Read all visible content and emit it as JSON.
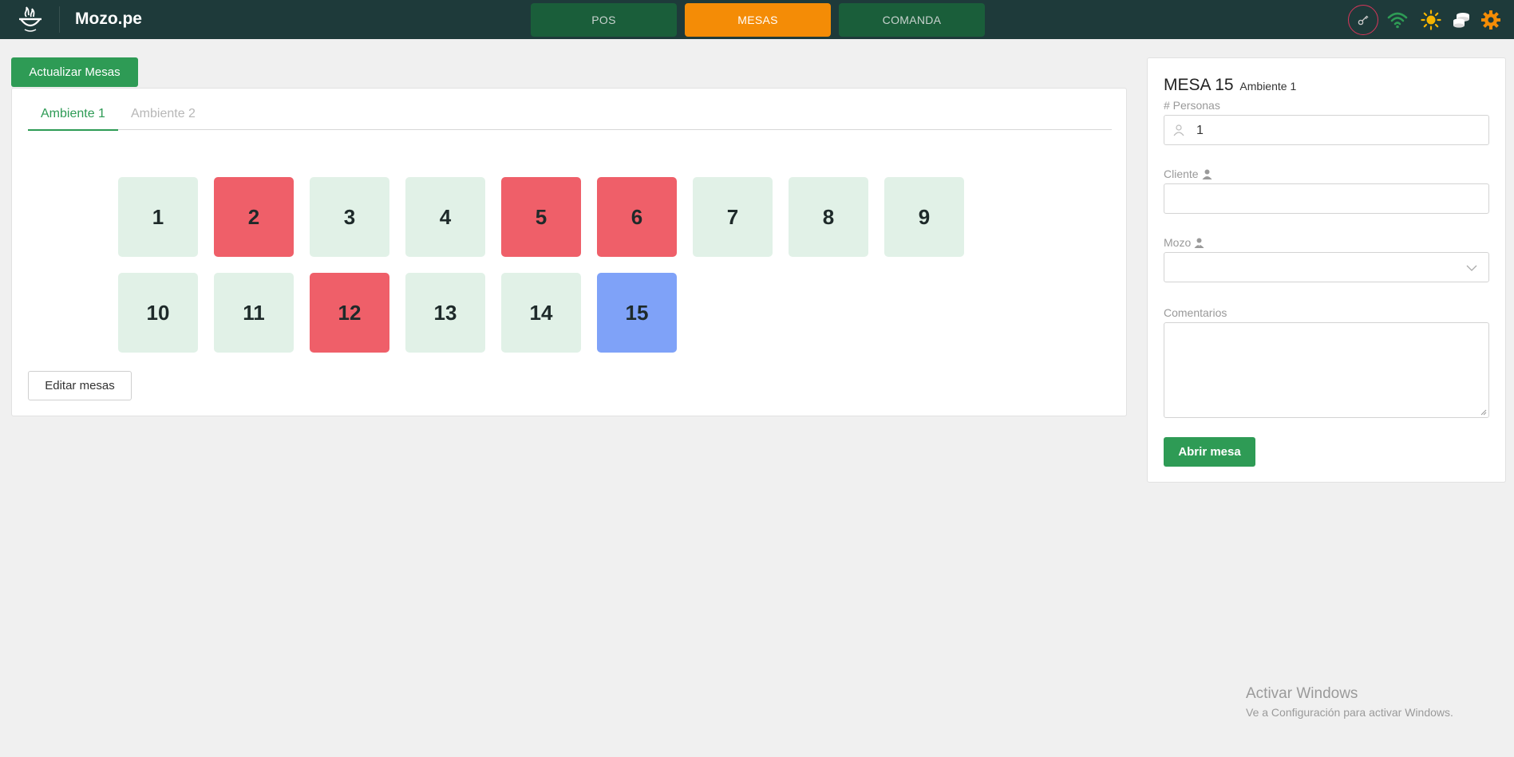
{
  "header": {
    "brand": "Mozo.pe",
    "nav": [
      {
        "label": "POS"
      },
      {
        "label": "MESAS"
      },
      {
        "label": "COMANDA"
      }
    ],
    "icons": [
      "key-icon",
      "wifi-icon",
      "sun-icon",
      "coins-icon",
      "gear-icon"
    ],
    "colors": {
      "bar": "#1e3a3a",
      "tab": "#1a5e3a",
      "active_tab": "#f48c06"
    }
  },
  "toolbar": {
    "update_label": "Actualizar Mesas"
  },
  "rooms": {
    "tabs": [
      {
        "label": "Ambiente 1"
      },
      {
        "label": "Ambiente 2"
      }
    ],
    "tables": [
      {
        "number": "1",
        "status": "free"
      },
      {
        "number": "2",
        "status": "busy"
      },
      {
        "number": "3",
        "status": "free"
      },
      {
        "number": "4",
        "status": "free"
      },
      {
        "number": "5",
        "status": "busy"
      },
      {
        "number": "6",
        "status": "busy"
      },
      {
        "number": "7",
        "status": "free"
      },
      {
        "number": "8",
        "status": "free"
      },
      {
        "number": "9",
        "status": "free"
      },
      {
        "number": "10",
        "status": "free"
      },
      {
        "number": "11",
        "status": "free"
      },
      {
        "number": "12",
        "status": "busy"
      },
      {
        "number": "13",
        "status": "free"
      },
      {
        "number": "14",
        "status": "free"
      },
      {
        "number": "15",
        "status": "selected"
      }
    ],
    "edit_label": "Editar mesas"
  },
  "detail": {
    "title": "MESA 15",
    "ambiente": "Ambiente 1",
    "personas_label": "# Personas",
    "personas_value": "1",
    "cliente_label": "Cliente",
    "mozo_label": "Mozo",
    "comentarios_label": "Comentarios",
    "open_label": "Abrir mesa"
  },
  "watermark": {
    "title": "Activar Windows",
    "subtitle": "Ve a Configuración para activar Windows."
  }
}
